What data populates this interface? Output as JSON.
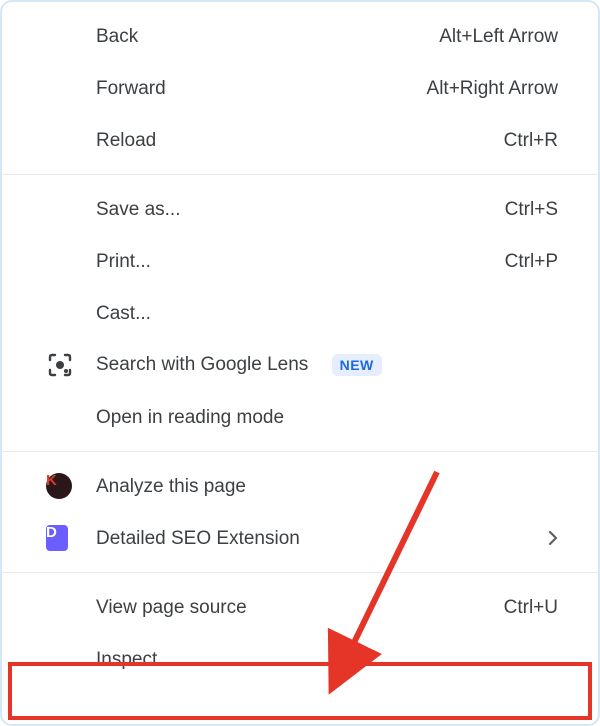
{
  "menu": {
    "groups": [
      {
        "name": "navigation-group",
        "items": [
          {
            "id": "menu-back",
            "label": "Back",
            "shortcut": "Alt+Left Arrow"
          },
          {
            "id": "menu-forward",
            "label": "Forward",
            "shortcut": "Alt+Right Arrow"
          },
          {
            "id": "menu-reload",
            "label": "Reload",
            "shortcut": "Ctrl+R"
          }
        ]
      },
      {
        "name": "page-actions-group",
        "items": [
          {
            "id": "menu-save-as",
            "label": "Save as...",
            "shortcut": "Ctrl+S"
          },
          {
            "id": "menu-print",
            "label": "Print...",
            "shortcut": "Ctrl+P"
          },
          {
            "id": "menu-cast",
            "label": "Cast..."
          },
          {
            "id": "menu-google-lens",
            "icon": "google-lens-icon",
            "label": "Search with Google Lens",
            "badge": "NEW"
          },
          {
            "id": "menu-reading-mode",
            "label": "Open in reading mode"
          }
        ]
      },
      {
        "name": "extensions-group",
        "items": [
          {
            "id": "menu-analyze-page",
            "icon": "k-extension-icon",
            "label": "Analyze this page"
          },
          {
            "id": "menu-detailed-seo",
            "icon": "d-extension-icon",
            "label": "Detailed SEO Extension",
            "submenu": true
          }
        ]
      },
      {
        "name": "dev-group",
        "items": [
          {
            "id": "menu-view-source",
            "label": "View page source",
            "shortcut": "Ctrl+U"
          },
          {
            "id": "menu-inspect",
            "label": "Inspect"
          }
        ]
      }
    ]
  },
  "flat": {
    "back_label": "Back",
    "back_shortcut": "Alt+Left Arrow",
    "forward_label": "Forward",
    "forward_shortcut": "Alt+Right Arrow",
    "reload_label": "Reload",
    "reload_shortcut": "Ctrl+R",
    "saveas_label": "Save as...",
    "saveas_shortcut": "Ctrl+S",
    "print_label": "Print...",
    "print_shortcut": "Ctrl+P",
    "cast_label": "Cast...",
    "lens_label": "Search with Google Lens",
    "lens_badge": "NEW",
    "reading_label": "Open in reading mode",
    "analyze_label": "Analyze this page",
    "seo_label": "Detailed SEO Extension",
    "source_label": "View page source",
    "source_shortcut": "Ctrl+U",
    "inspect_label": "Inspect"
  },
  "annotation": {
    "highlight_target": "menu-inspect",
    "arrow_color": "#e53528"
  }
}
